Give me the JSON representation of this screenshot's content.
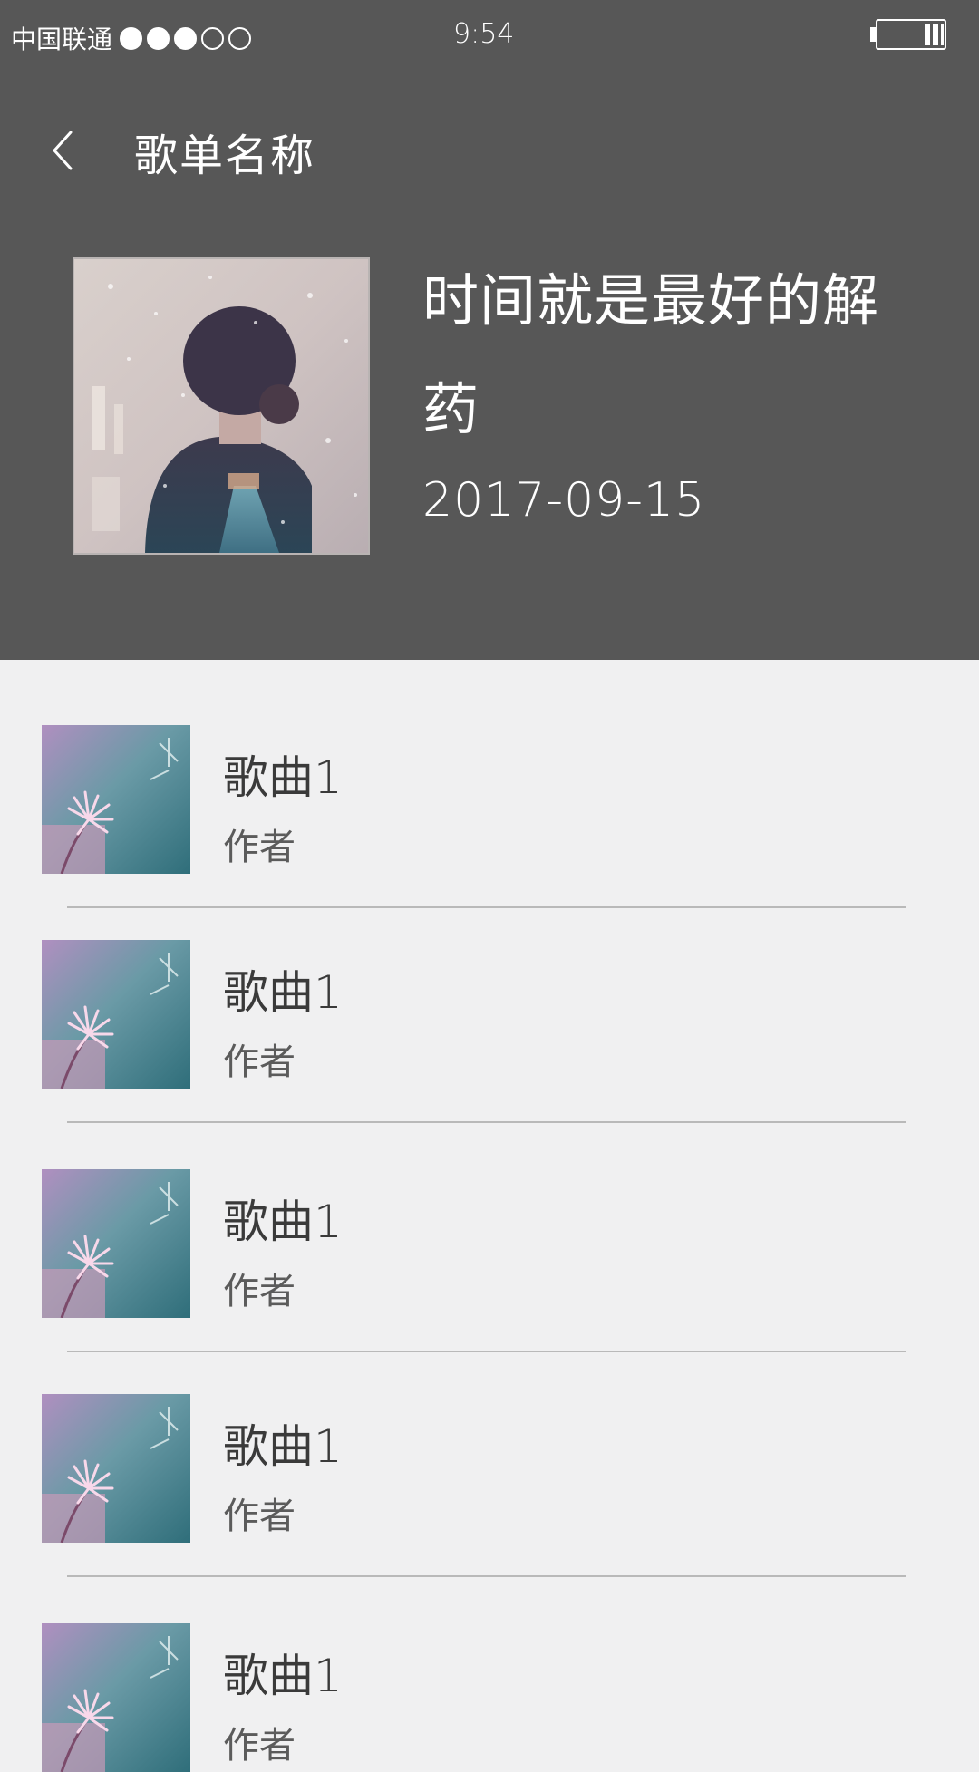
{
  "status_bar": {
    "carrier": "中国联通",
    "signal_filled": 3,
    "signal_total": 5,
    "time": "9:54",
    "battery_icon": "battery-icon"
  },
  "nav": {
    "back_icon": "chevron-left-icon",
    "title": "歌单名称"
  },
  "playlist": {
    "title": "时间就是最好的解药",
    "date": "2017-09-15"
  },
  "songs": [
    {
      "title": "歌曲1",
      "artist": "作者"
    },
    {
      "title": "歌曲1",
      "artist": "作者"
    },
    {
      "title": "歌曲1",
      "artist": "作者"
    },
    {
      "title": "歌曲1",
      "artist": "作者"
    },
    {
      "title": "歌曲1",
      "artist": "作者"
    }
  ],
  "colors": {
    "header_bg": "#575757",
    "list_bg": "#f0f0f1",
    "divider": "#b9b9b9"
  }
}
